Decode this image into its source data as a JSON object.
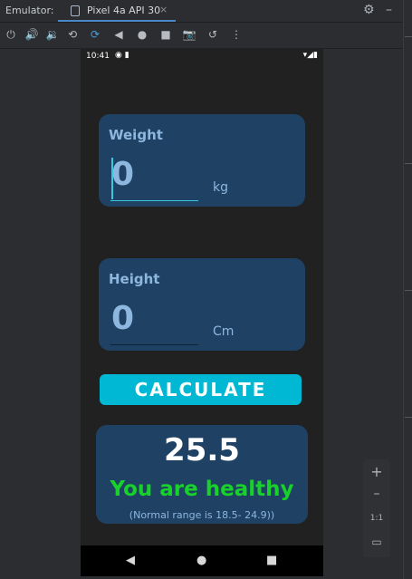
{
  "toolbar_top": {
    "label": "Emulator:",
    "tab_title": "Pixel 4a API 30",
    "tab_close": "×",
    "settings_icon": "⚙",
    "minimize_icon": "–"
  },
  "toolbar_icons": {
    "power": "⏻",
    "volume_up": "🔊",
    "volume_down": "🔉",
    "rotate_left": "⟲",
    "rotate_right": "⟳",
    "back": "◀",
    "home": "●",
    "overview": "■",
    "camera": "📷",
    "replay": "↺",
    "more": "⋮"
  },
  "status_bar": {
    "time": "10:41",
    "left_icons": "◉ ▮",
    "right_icons": "▾◢▮"
  },
  "weight_card": {
    "title": "Weight",
    "value": "0",
    "unit": "kg"
  },
  "height_card": {
    "title": "Height",
    "value": "0",
    "unit": "Cm"
  },
  "calculate_button": "CALCULATE",
  "result": {
    "bmi": "25.5",
    "status": "You are healthy",
    "range": "(Normal range is 18.5- 24.9))"
  },
  "nav": {
    "back": "◀",
    "home": "●",
    "recents": "■"
  },
  "zoom_panel": {
    "plus": "+",
    "minus": "–",
    "one_to_one": "1:1",
    "fit": "▭"
  },
  "colors": {
    "card_bg": "#1f4163",
    "accent": "#00b8d4",
    "healthy": "#18d12a",
    "text_muted": "#8db7df"
  }
}
